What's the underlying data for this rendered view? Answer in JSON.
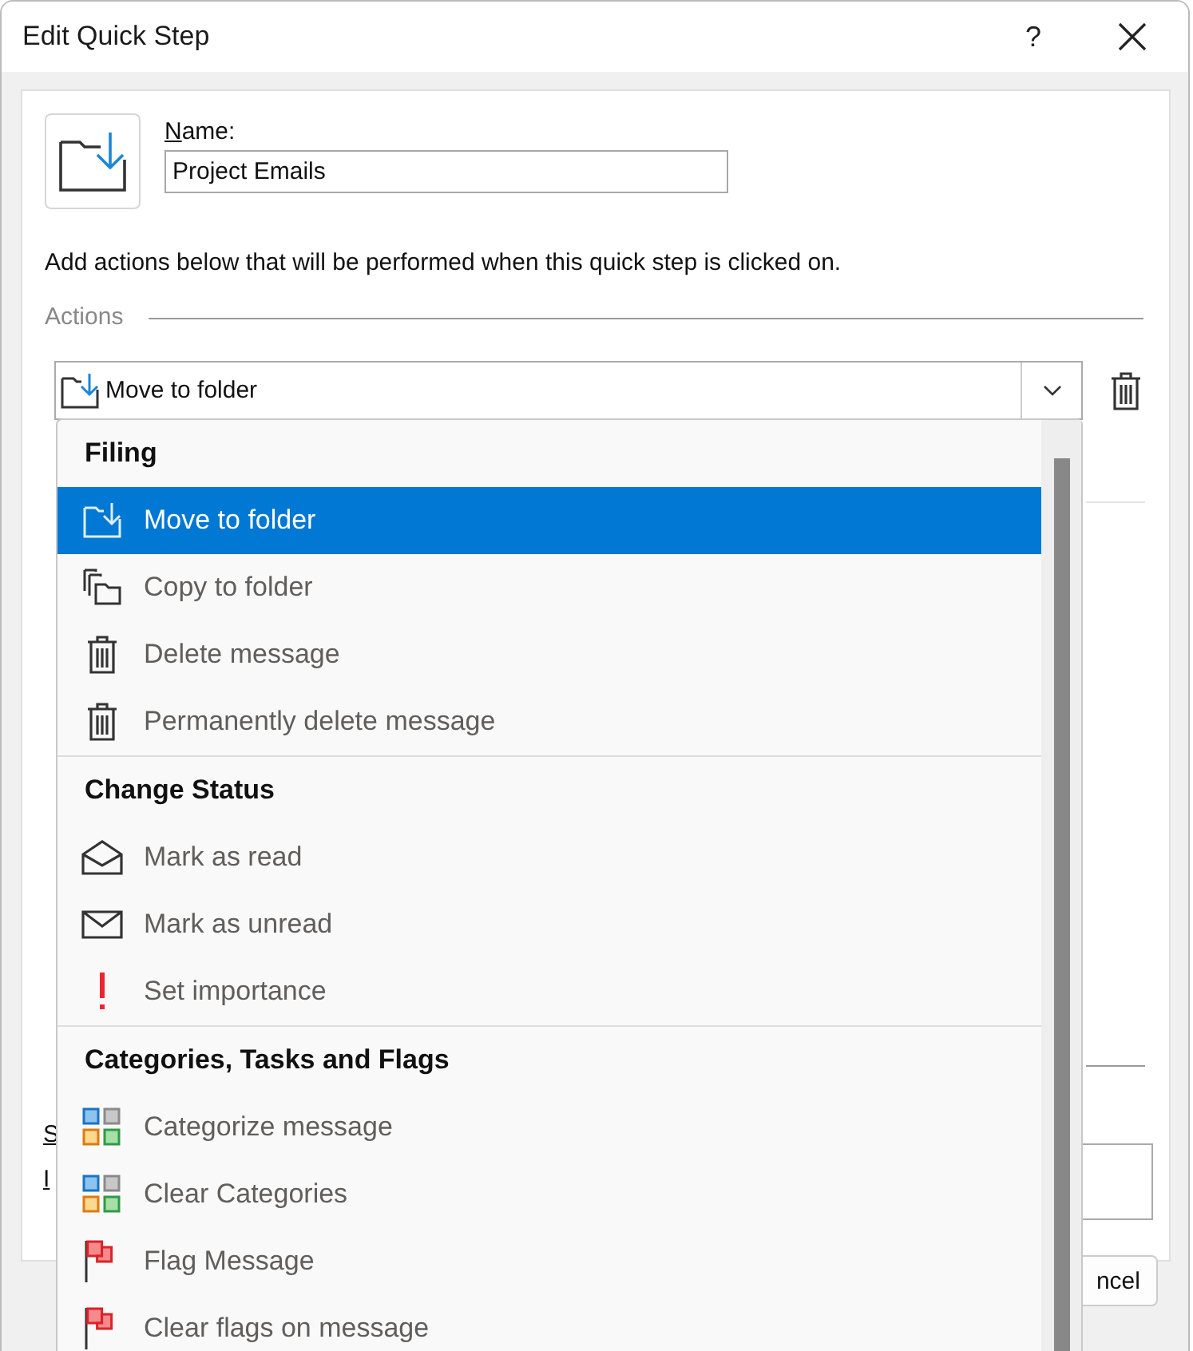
{
  "window": {
    "title": "Edit Quick Step",
    "help": "?"
  },
  "name_field": {
    "mnemonic": "N",
    "label_rest": "ame:",
    "value": "Project Emails"
  },
  "description": "Add actions below that will be performed when this quick step is clicked on.",
  "actions_label": "Actions",
  "action_combo": {
    "value": "Move to folder",
    "kind": "move"
  },
  "hidden_behind": {
    "rows": [
      {
        "label": "S",
        "underlined": true
      },
      {
        "label": "I",
        "underlined": true
      }
    ],
    "cancel_button": "ncel"
  },
  "dropdown": {
    "groups": [
      {
        "title": "Filing",
        "items": [
          {
            "label": "Move to folder",
            "kind": "move",
            "selected": true
          },
          {
            "label": "Copy to folder",
            "kind": "copy",
            "selected": false
          },
          {
            "label": "Delete message",
            "kind": "trash",
            "selected": false
          },
          {
            "label": "Permanently delete message",
            "kind": "trash",
            "selected": false
          }
        ]
      },
      {
        "title": "Change Status",
        "items": [
          {
            "label": "Mark as read",
            "kind": "open-envelope",
            "selected": false
          },
          {
            "label": "Mark as unread",
            "kind": "envelope",
            "selected": false
          },
          {
            "label": "Set importance",
            "kind": "exclamation",
            "selected": false
          }
        ]
      },
      {
        "title": "Categories, Tasks and Flags",
        "items": [
          {
            "label": "Categorize message",
            "kind": "categories",
            "selected": false
          },
          {
            "label": "Clear Categories",
            "kind": "categories",
            "selected": false
          },
          {
            "label": "Flag Message",
            "kind": "flag",
            "selected": false
          },
          {
            "label": "Clear flags on message",
            "kind": "flag",
            "selected": false
          }
        ]
      }
    ]
  }
}
